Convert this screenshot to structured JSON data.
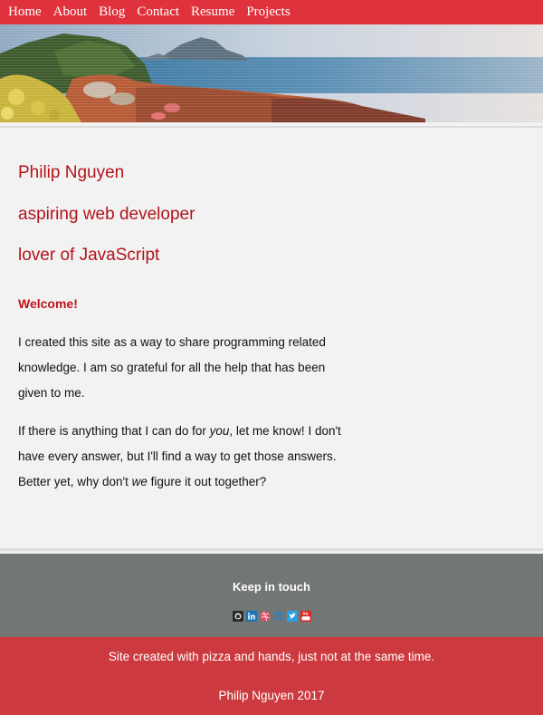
{
  "nav": {
    "items": [
      {
        "label": "Home"
      },
      {
        "label": "About"
      },
      {
        "label": "Blog"
      },
      {
        "label": "Contact"
      },
      {
        "label": "Resume"
      },
      {
        "label": "Projects"
      }
    ]
  },
  "hero": {
    "name": "Philip Nguyen",
    "tagline_1": "aspiring web developer",
    "tagline_2": "lover of JavaScript"
  },
  "content": {
    "welcome": "Welcome!",
    "paragraph_1": "I created this site as a way to share programming related knowledge. I am so grateful for all the help that has been given to me.",
    "paragraph_2_part_1": "If there is anything that I can do for ",
    "paragraph_2_em_1": "you",
    "paragraph_2_part_2": ", let me know! I don't have every answer, but I'll find a way to get those answers. Better yet, why don't ",
    "paragraph_2_em_2": "we",
    "paragraph_2_part_3": " figure it out together?"
  },
  "footer": {
    "title": "Keep in touch",
    "social_icons": [
      "github-icon",
      "linkedin-icon",
      "dribbble-icon",
      "bitbucket-icon",
      "twitter-icon",
      "youtube-icon"
    ],
    "credit": "Site created with pizza and hands, just not at the same time.",
    "copyright": "Philip Nguyen 2017"
  },
  "colors": {
    "nav_bg": "#e0323c",
    "accent_text": "#b3131b",
    "touch_bg": "#727674",
    "credits_bg": "#cc3a3f"
  }
}
